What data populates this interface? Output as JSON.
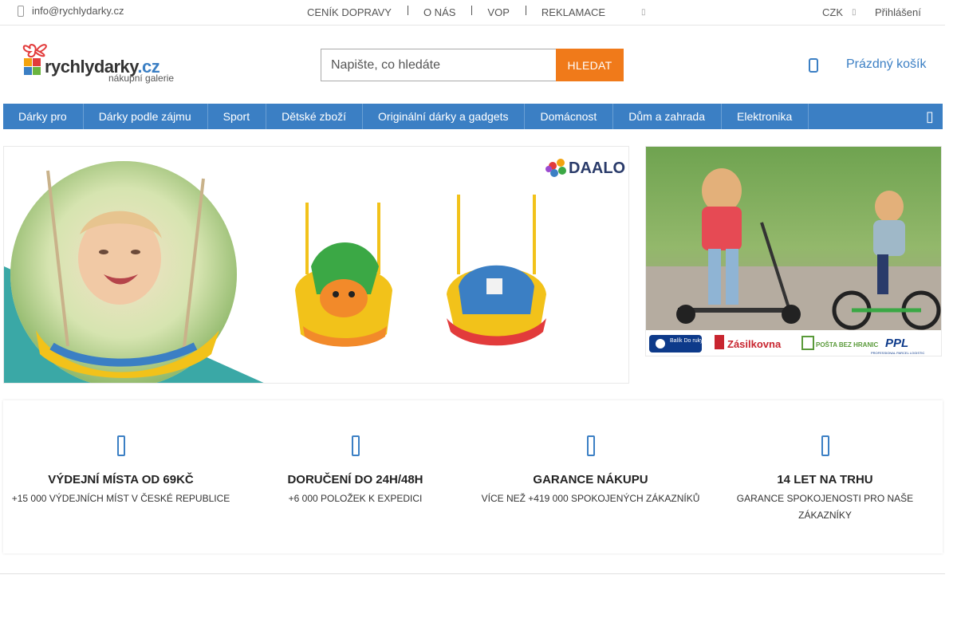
{
  "topbar": {
    "email": "info@rychlydarky.cz",
    "links": [
      "CENÍK DOPRAVY",
      "O NÁS",
      "VOP",
      "REKLAMACE"
    ],
    "currency": "CZK",
    "login": "Přihlášení"
  },
  "logo": {
    "brand": "rychlydarky",
    "tld": ".cz",
    "subtitle": "nákupní galerie"
  },
  "search": {
    "placeholder": "Napište, co hledáte",
    "button": "HLEDAT"
  },
  "cart": {
    "label": "Prázdný košík"
  },
  "nav": {
    "items": [
      "Dárky pro",
      "Dárky podle zájmu",
      "Sport",
      "Dětské zboží",
      "Originální dárky a gadgets",
      "Domácnost",
      "Dům a zahrada",
      "Elektronika"
    ]
  },
  "banners": {
    "main_logo": "DAALO",
    "side_carriers": [
      "Balík Do ruky",
      "Zásilkovna",
      "POŠTA BEZ HRANIC",
      "PPL",
      "PROFESSIONAL PARCEL LOGISTIC"
    ]
  },
  "features": [
    {
      "title": "VÝDEJNÍ MÍSTA OD 69KČ",
      "desc": "+15 000 VÝDEJNÍCH MÍST V ČESKÉ REPUBLICE"
    },
    {
      "title": "DORUČENÍ DO 24H/48H",
      "desc": "+6 000 POLOŽEK K EXPEDICI"
    },
    {
      "title": "GARANCE NÁKUPU",
      "desc": "VÍCE NEŽ +419 000 SPOKOJENÝCH ZÁKAZNÍKŮ"
    },
    {
      "title": "14 LET NA TRHU",
      "desc": "GARANCE SPOKOJENOSTI PRO NAŠE ZÁKAZNÍKY"
    }
  ],
  "colors": {
    "accent": "#3b7fc4",
    "button": "#f07a1a"
  }
}
